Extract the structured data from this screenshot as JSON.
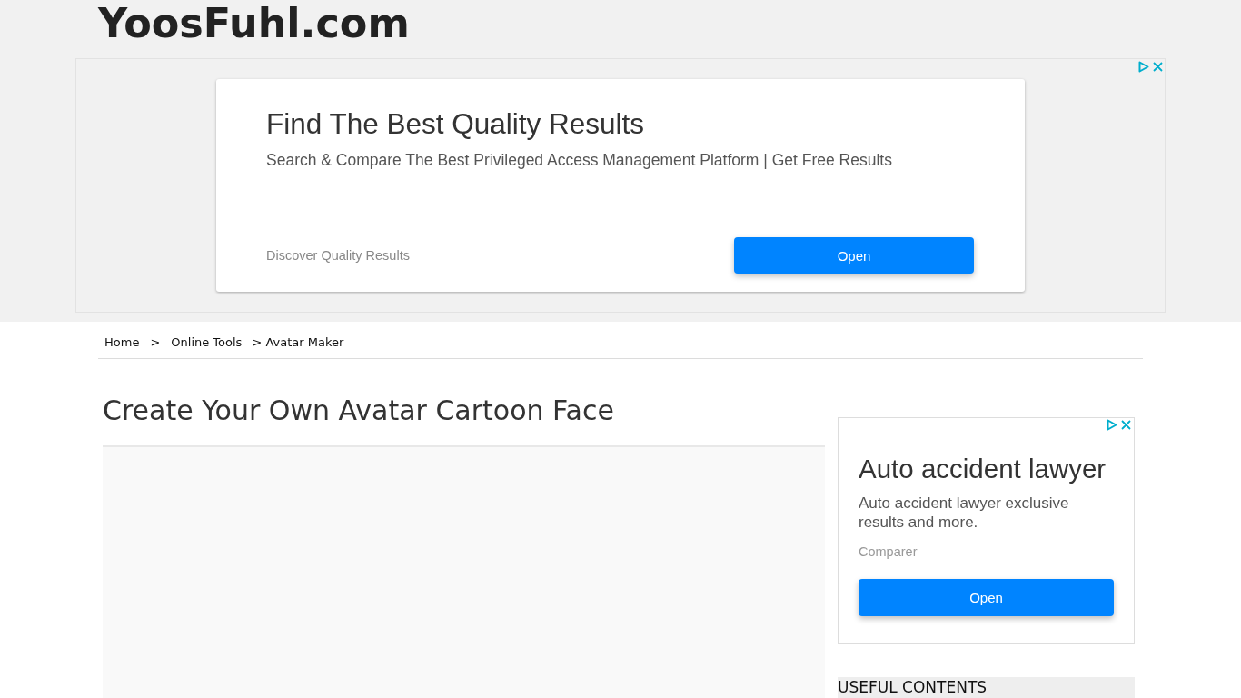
{
  "site": {
    "logo": "YoosFuhl.com"
  },
  "top_ad": {
    "title": "Find The Best Quality Results",
    "description": "Search & Compare The Best Privileged Access Management Platform | Get Free Results",
    "source": "Discover Quality Results",
    "button": "Open"
  },
  "breadcrumbs": [
    {
      "kind": "link",
      "label": "Home"
    },
    {
      "kind": "separator",
      "label": ">"
    },
    {
      "kind": "link",
      "label": "Online Tools"
    },
    {
      "kind": "current",
      "label": "> Avatar Maker"
    }
  ],
  "page": {
    "title": "Create Your Own Avatar Cartoon Face"
  },
  "side_ad": {
    "title": "Auto accident lawyer",
    "description": "Auto accident lawyer exclusive results and more.",
    "source": "Comparer",
    "button": "Open"
  },
  "sidebar": {
    "heading": "USEFUL CONTENTS"
  }
}
